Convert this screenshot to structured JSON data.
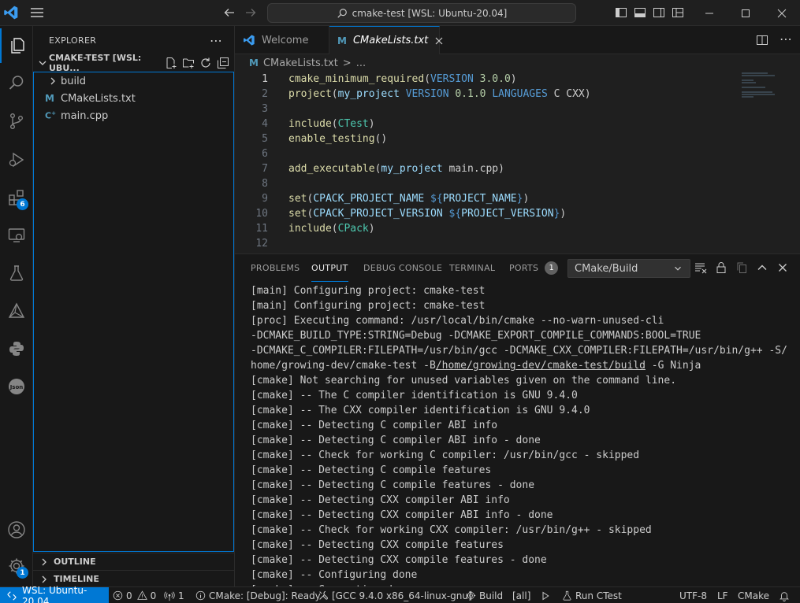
{
  "colors": {
    "accent": "#0078d4",
    "background": "#1f1f1f",
    "sidebar": "#181818"
  },
  "titlebar": {
    "command_center": "cmake-test [WSL: Ubuntu-20.04]"
  },
  "activity_bar": {
    "items": [
      {
        "icon": "files-icon"
      },
      {
        "icon": "search-icon"
      },
      {
        "icon": "source-control-icon"
      },
      {
        "icon": "run-debug-icon"
      },
      {
        "icon": "extensions-icon",
        "badge": "6"
      },
      {
        "icon": "remote-explorer-icon"
      },
      {
        "icon": "testing-icon"
      },
      {
        "icon": "cmake-icon"
      },
      {
        "icon": "python-icon"
      },
      {
        "icon": "json-icon"
      }
    ],
    "accounts_icon": "account-icon",
    "manage_icon": "gear-icon",
    "manage_badge": "1"
  },
  "sidebar": {
    "title": "EXPLORER",
    "folder": "CMAKE-TEST [WSL: UBU...",
    "tree": [
      {
        "label": "build",
        "type": "folder"
      },
      {
        "label": "CMakeLists.txt",
        "type": "cmake"
      },
      {
        "label": "main.cpp",
        "type": "cpp"
      }
    ],
    "outline": "OUTLINE",
    "timeline": "TIMELINE"
  },
  "tabs": [
    {
      "label": "Welcome",
      "active": false
    },
    {
      "label": "CMakeLists.txt",
      "active": true
    }
  ],
  "breadcrumb": {
    "file": "CMakeLists.txt",
    "sep": ">",
    "rest": "..."
  },
  "editor": {
    "lines": [
      {
        "n": "1",
        "tokens": [
          [
            "fn",
            "cmake_minimum_required"
          ],
          [
            "op",
            "("
          ],
          [
            "kw",
            "VERSION"
          ],
          [
            "tx",
            " "
          ],
          [
            "num",
            "3.0.0"
          ],
          [
            "op",
            ")"
          ]
        ]
      },
      {
        "n": "2",
        "tokens": [
          [
            "fn",
            "project"
          ],
          [
            "op",
            "("
          ],
          [
            "var",
            "my_project"
          ],
          [
            "tx",
            " "
          ],
          [
            "kw",
            "VERSION"
          ],
          [
            "tx",
            " "
          ],
          [
            "num",
            "0.1.0"
          ],
          [
            "tx",
            " "
          ],
          [
            "kw",
            "LANGUAGES"
          ],
          [
            "tx",
            " C CXX"
          ],
          [
            "op",
            ")"
          ]
        ]
      },
      {
        "n": "3",
        "tokens": []
      },
      {
        "n": "4",
        "tokens": [
          [
            "fn",
            "include"
          ],
          [
            "op",
            "("
          ],
          [
            "mac",
            "CTest"
          ],
          [
            "op",
            ")"
          ]
        ]
      },
      {
        "n": "5",
        "tokens": [
          [
            "fn",
            "enable_testing"
          ],
          [
            "op",
            "()"
          ]
        ]
      },
      {
        "n": "6",
        "tokens": []
      },
      {
        "n": "7",
        "tokens": [
          [
            "fn",
            "add_executable"
          ],
          [
            "op",
            "("
          ],
          [
            "var",
            "my_project"
          ],
          [
            "tx",
            " main.cpp"
          ],
          [
            "op",
            ")"
          ]
        ]
      },
      {
        "n": "8",
        "tokens": []
      },
      {
        "n": "9",
        "tokens": [
          [
            "fn",
            "set"
          ],
          [
            "op",
            "("
          ],
          [
            "var",
            "CPACK_PROJECT_NAME"
          ],
          [
            "tx",
            " "
          ],
          [
            "kw",
            "${"
          ],
          [
            "var",
            "PROJECT_NAME"
          ],
          [
            "kw",
            "}"
          ],
          [
            "op",
            ")"
          ]
        ]
      },
      {
        "n": "10",
        "tokens": [
          [
            "fn",
            "set"
          ],
          [
            "op",
            "("
          ],
          [
            "var",
            "CPACK_PROJECT_VERSION"
          ],
          [
            "tx",
            " "
          ],
          [
            "kw",
            "${"
          ],
          [
            "var",
            "PROJECT_VERSION"
          ],
          [
            "kw",
            "}"
          ],
          [
            "op",
            ")"
          ]
        ]
      },
      {
        "n": "11",
        "tokens": [
          [
            "fn",
            "include"
          ],
          [
            "op",
            "("
          ],
          [
            "mac",
            "CPack"
          ],
          [
            "op",
            ")"
          ]
        ]
      },
      {
        "n": "12",
        "tokens": []
      }
    ]
  },
  "panel": {
    "tabs": [
      "PROBLEMS",
      "OUTPUT",
      "DEBUG CONSOLE",
      "TERMINAL",
      "PORTS"
    ],
    "ports_badge": "1",
    "channel": "CMake/Build",
    "output": [
      "[main] Configuring project: cmake-test",
      "[main] Configuring project: cmake-test",
      "[proc] Executing command: /usr/local/bin/cmake --no-warn-unused-cli",
      "-DCMAKE_BUILD_TYPE:STRING=Debug -DCMAKE_EXPORT_COMPILE_COMMANDS:BOOL=TRUE",
      "-DCMAKE_C_COMPILER:FILEPATH=/usr/bin/gcc -DCMAKE_CXX_COMPILER:FILEPATH=/usr/bin/g++ -S/",
      "home/growing-dev/cmake-test -B/home/growing-dev/cmake-test/build -G Ninja",
      "[cmake] Not searching for unused variables given on the command line.",
      "[cmake] -- The C compiler identification is GNU 9.4.0",
      "[cmake] -- The CXX compiler identification is GNU 9.4.0",
      "[cmake] -- Detecting C compiler ABI info",
      "[cmake] -- Detecting C compiler ABI info - done",
      "[cmake] -- Check for working C compiler: /usr/bin/gcc - skipped",
      "[cmake] -- Detecting C compile features",
      "[cmake] -- Detecting C compile features - done",
      "[cmake] -- Detecting CXX compiler ABI info",
      "[cmake] -- Detecting CXX compiler ABI info - done",
      "[cmake] -- Check for working CXX compiler: /usr/bin/g++ - skipped",
      "[cmake] -- Detecting CXX compile features",
      "[cmake] -- Detecting CXX compile features - done",
      "[cmake] -- Configuring done",
      "[cmake] -- Generating done"
    ]
  },
  "statusbar": {
    "remote": "WSL: Ubuntu-20.04",
    "errors": "0",
    "warnings": "0",
    "ports": "1",
    "cmake_status": "CMake: [Debug]: Ready",
    "kit": "[GCC 9.4.0 x86_64-linux-gnu]",
    "build": "Build",
    "target": "[all]",
    "ctest": "Run CTest",
    "encoding": "UTF-8",
    "eol": "LF",
    "language": "CMake"
  }
}
